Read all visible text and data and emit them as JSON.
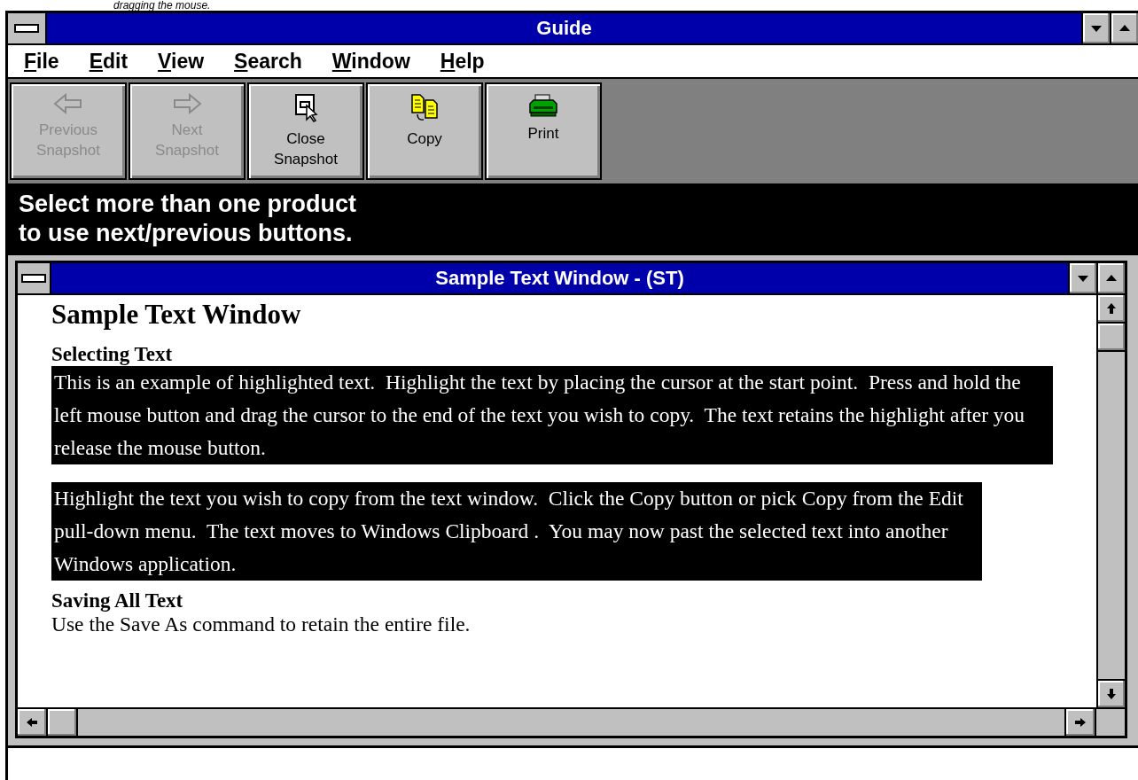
{
  "top_text": "dragging the mouse.",
  "window": {
    "title": "Guide"
  },
  "menu": [
    {
      "label": "File"
    },
    {
      "label": "Edit"
    },
    {
      "label": "View"
    },
    {
      "label": "Search"
    },
    {
      "label": "Window"
    },
    {
      "label": "Help"
    }
  ],
  "toolbar": [
    {
      "kind": "back",
      "lines": [
        "Previous",
        "Snapshot"
      ],
      "disabled": true
    },
    {
      "kind": "forward",
      "lines": [
        "Next",
        "Snapshot"
      ],
      "disabled": true
    },
    {
      "kind": "close",
      "lines": [
        "Close",
        "Snapshot"
      ],
      "disabled": false
    },
    {
      "kind": "copy",
      "lines": [
        "Copy"
      ],
      "disabled": false
    },
    {
      "kind": "print",
      "lines": [
        "Print"
      ],
      "disabled": false
    }
  ],
  "message": [
    "Select more than one product",
    "to use next/previous buttons."
  ],
  "child_window": {
    "title": "Sample Text Window - (ST)",
    "heading": "Sample Text Window",
    "sections": [
      {
        "heading": "Selecting Text",
        "paragraphs": [
          {
            "text": "This is an example of highlighted text.  Highlight the text by placing the cursor at the start point.  Press and hold the left mouse button and drag the cursor to the end of the text you wish to copy.  The text retains the highlight after you release the mouse button.",
            "highlighted": true
          },
          {
            "text": "Highlight the text you wish to copy from the text window.  Click the Copy button or pick Copy from the Edit pull-down menu.  The text moves to Windows Clipboard .  You may now past the selected text into another Windows application.",
            "highlighted": true
          }
        ]
      },
      {
        "heading": "Saving All Text",
        "paragraphs": [
          {
            "text": "Use the Save As command to retain the entire file.",
            "highlighted": false
          }
        ]
      }
    ]
  }
}
